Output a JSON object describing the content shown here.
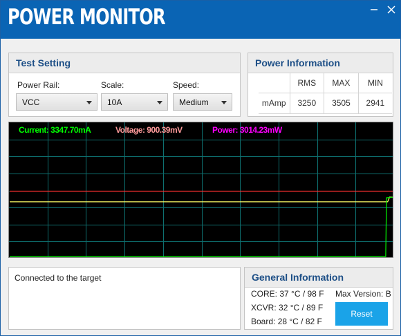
{
  "window": {
    "title": "POWER MONITOR"
  },
  "colors": {
    "titlebar": "#0a64b4",
    "current": "#00ff00",
    "voltage": "#ff9b9b",
    "power": "#ff00ff",
    "grid": "#0e7070",
    "accent": "#1aa3e8"
  },
  "test_setting": {
    "title": "Test Setting",
    "power_rail": {
      "label": "Power Rail:",
      "value": "VCC"
    },
    "scale": {
      "label": "Scale:",
      "value": "10A"
    },
    "speed": {
      "label": "Speed:",
      "value": "Medium"
    }
  },
  "power_info": {
    "title": "Power Information",
    "columns": [
      "RMS",
      "MAX",
      "MIN"
    ],
    "row": {
      "label": "mAmp",
      "values": [
        "3250",
        "3505",
        "2941"
      ]
    }
  },
  "monitor": {
    "current": "Current: 3347.70mA",
    "voltage": "Voltage: 900.39mV",
    "power": "Power: 3014.23mW"
  },
  "chart_data": {
    "type": "line",
    "grid": true,
    "x_divisions": 10,
    "y_divisions": 8,
    "series": [
      {
        "color": "#ff3030",
        "points": [
          [
            0,
            4.95
          ],
          [
            1,
            4.95
          ]
        ]
      },
      {
        "color": "#ffff66",
        "points": [
          [
            0,
            4.15
          ],
          [
            0.985,
            4.15
          ],
          [
            0.99,
            4.5
          ],
          [
            1,
            4.5
          ]
        ]
      },
      {
        "color": "#00ff00",
        "points": [
          [
            0,
            0.05
          ],
          [
            0.98,
            0.05
          ],
          [
            0.982,
            4.45
          ],
          [
            1,
            4.5
          ]
        ]
      }
    ],
    "y_range": [
      0,
      10
    ]
  },
  "status": {
    "text": "Connected to the target"
  },
  "general_info": {
    "title": "General Information",
    "core": {
      "label": "CORE:",
      "value": "37 °C / 98 F"
    },
    "xcvr": {
      "label": "XCVR:",
      "value": "32 °C / 89 F"
    },
    "board": {
      "label": "Board:",
      "value": "28 °C / 82 F"
    },
    "max_version": {
      "label": "Max Version:",
      "value": "B"
    },
    "reset_label": "Reset"
  }
}
